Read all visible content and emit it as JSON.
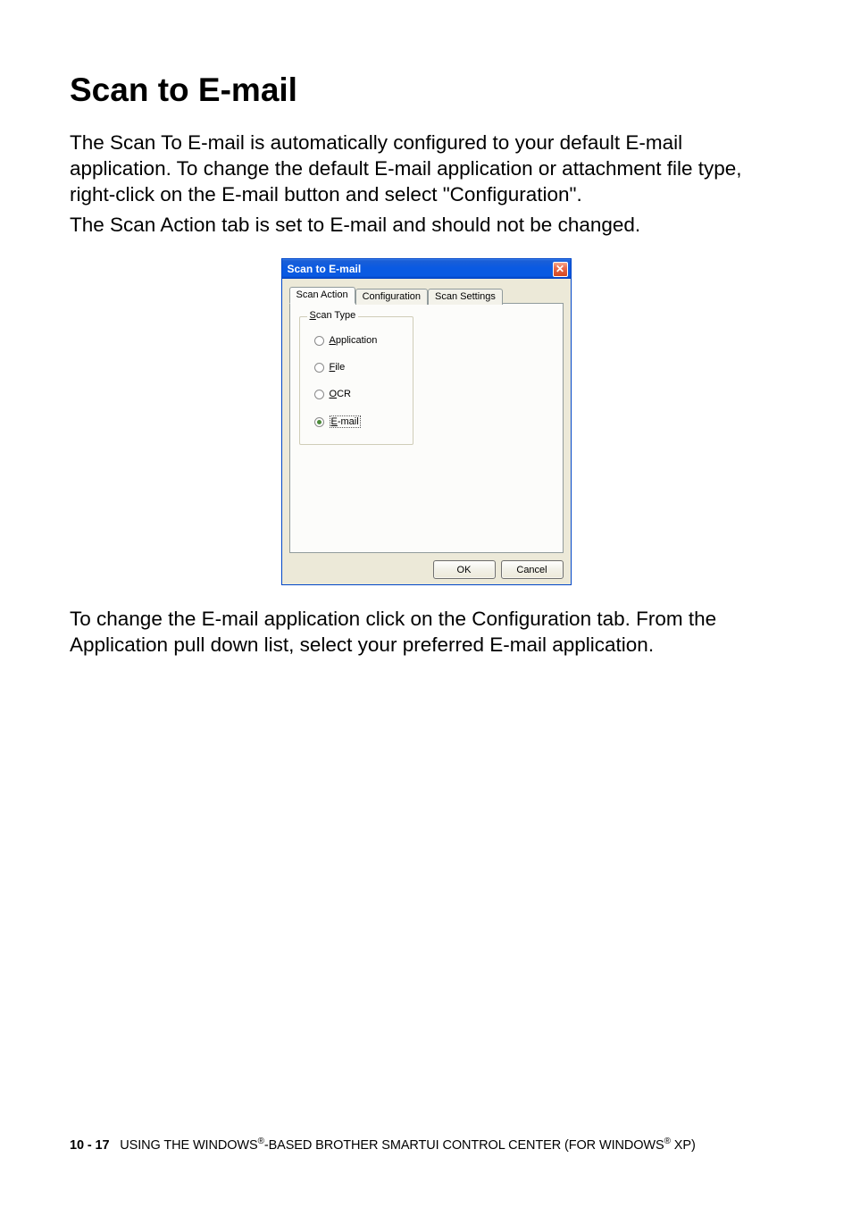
{
  "heading": "Scan to E-mail",
  "para1": "The Scan To E-mail is automatically configured to your default E-mail application. To change the default E-mail application or attachment file type, right-click on the E-mail button and select \"Configuration\".",
  "para2": "The Scan Action tab is set to E-mail and should not be changed.",
  "para3": "To change the E-mail application click on the Configuration tab. From the Application pull down list, select your preferred E-mail application.",
  "dialog": {
    "title": "Scan to E-mail",
    "tabs": {
      "scan_action": "Scan Action",
      "configuration": "Configuration",
      "scan_settings": "Scan Settings"
    },
    "group": {
      "label_pre": "S",
      "label_post": "can Type"
    },
    "options": {
      "application": {
        "ul": "A",
        "rest": "pplication"
      },
      "file": {
        "ul": "F",
        "rest": "ile"
      },
      "ocr": {
        "ul": "O",
        "rest": "CR"
      },
      "email": {
        "ul": "E",
        "rest": "-mail"
      }
    },
    "buttons": {
      "ok": "OK",
      "cancel": "Cancel"
    }
  },
  "footer": {
    "pageno": "10 - 17",
    "text_pre": "USING THE WINDOWS",
    "reg1": "®",
    "text_mid": "-BASED BROTHER SMARTUI CONTROL CENTER (FOR WINDOWS",
    "reg2": "®",
    "text_post": " XP)"
  }
}
